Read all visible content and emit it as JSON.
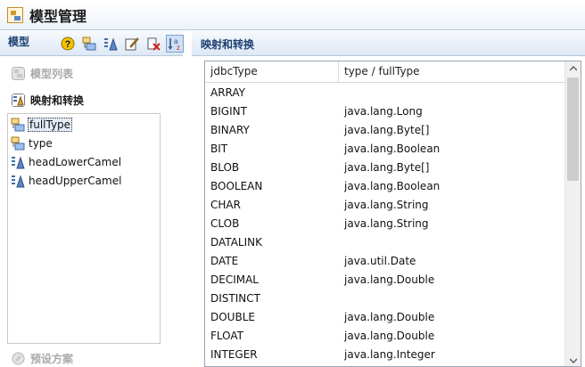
{
  "window": {
    "title": "模型管理"
  },
  "left_panel": {
    "header": "模型",
    "toolbar": [
      {
        "icon": "help-icon"
      },
      {
        "icon": "model-list-icon"
      },
      {
        "icon": "field-mapping-icon"
      },
      {
        "icon": "edit-icon"
      },
      {
        "icon": "delete-icon"
      },
      {
        "icon": "sort-az-icon",
        "active": true
      }
    ],
    "sections": {
      "model_list": "模型列表",
      "mapping": "映射和转换",
      "preset": "预设方案"
    },
    "tree": [
      {
        "label": "fullType",
        "icon": "mapping-type-icon",
        "selected": true
      },
      {
        "label": "type",
        "icon": "mapping-type-icon",
        "selected": false
      },
      {
        "label": "headLowerCamel",
        "icon": "transform-icon",
        "selected": false
      },
      {
        "label": "headUpperCamel",
        "icon": "transform-icon",
        "selected": false
      }
    ]
  },
  "right_panel": {
    "header": "映射和转换",
    "columns": [
      "jdbcType",
      "type / fullType"
    ],
    "rows": [
      [
        "ARRAY",
        ""
      ],
      [
        "BIGINT",
        "java.lang.Long"
      ],
      [
        "BINARY",
        "java.lang.Byte[]"
      ],
      [
        "BIT",
        "java.lang.Boolean"
      ],
      [
        "BLOB",
        "java.lang.Byte[]"
      ],
      [
        "BOOLEAN",
        "java.lang.Boolean"
      ],
      [
        "CHAR",
        "java.lang.String"
      ],
      [
        "CLOB",
        "java.lang.String"
      ],
      [
        "DATALINK",
        ""
      ],
      [
        "DATE",
        "java.util.Date"
      ],
      [
        "DECIMAL",
        "java.lang.Double"
      ],
      [
        "DISTINCT",
        ""
      ],
      [
        "DOUBLE",
        "java.lang.Double"
      ],
      [
        "FLOAT",
        "java.lang.Double"
      ],
      [
        "INTEGER",
        "java.lang.Integer"
      ]
    ]
  }
}
